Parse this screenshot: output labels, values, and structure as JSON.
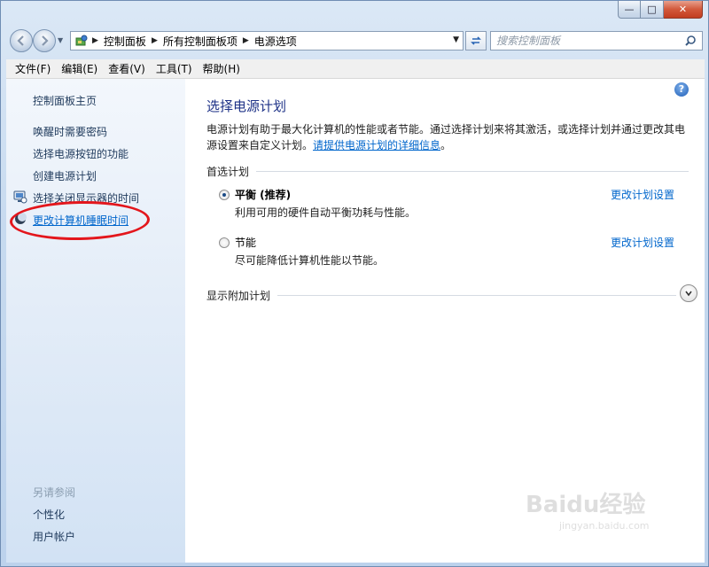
{
  "window": {
    "min_glyph": "—",
    "max_glyph": "□",
    "close_glyph": "✕"
  },
  "address": {
    "crumbs": [
      "控制面板",
      "所有控制面板项",
      "电源选项"
    ],
    "search_placeholder": "搜索控制面板"
  },
  "menu": [
    "文件(F)",
    "编辑(E)",
    "查看(V)",
    "工具(T)",
    "帮助(H)"
  ],
  "sidebar": {
    "home": "控制面板主页",
    "tasks": [
      {
        "label": "唤醒时需要密码",
        "icon": ""
      },
      {
        "label": "选择电源按钮的功能",
        "icon": ""
      },
      {
        "label": "创建电源计划",
        "icon": ""
      },
      {
        "label": "选择关闭显示器的时间",
        "icon": "monitor-icon"
      },
      {
        "label": "更改计算机睡眠时间",
        "icon": "moon-icon"
      }
    ],
    "see_also_heading": "另请参阅",
    "see_also": [
      "个性化",
      "用户帐户"
    ]
  },
  "main": {
    "title": "选择电源计划",
    "intro_text": "电源计划有助于最大化计算机的性能或者节能。通过选择计划来将其激活，或选择计划并通过更改其电源设置来自定义计划。",
    "intro_link": "请提供电源计划的详细信息",
    "intro_end": "。",
    "preferred_heading": "首选计划",
    "plans": [
      {
        "name": "平衡 (推荐)",
        "desc": "利用可用的硬件自动平衡功耗与性能。",
        "link": "更改计划设置",
        "selected": true
      },
      {
        "name": "节能",
        "desc": "尽可能降低计算机性能以节能。",
        "link": "更改计划设置",
        "selected": false
      }
    ],
    "more_heading": "显示附加计划"
  },
  "watermark": {
    "main": "Baidu经验",
    "sub": "jingyan.baidu.com"
  },
  "colors": {
    "link": "#0066cc",
    "title": "#1e3287",
    "annotation": "#e3161c"
  }
}
